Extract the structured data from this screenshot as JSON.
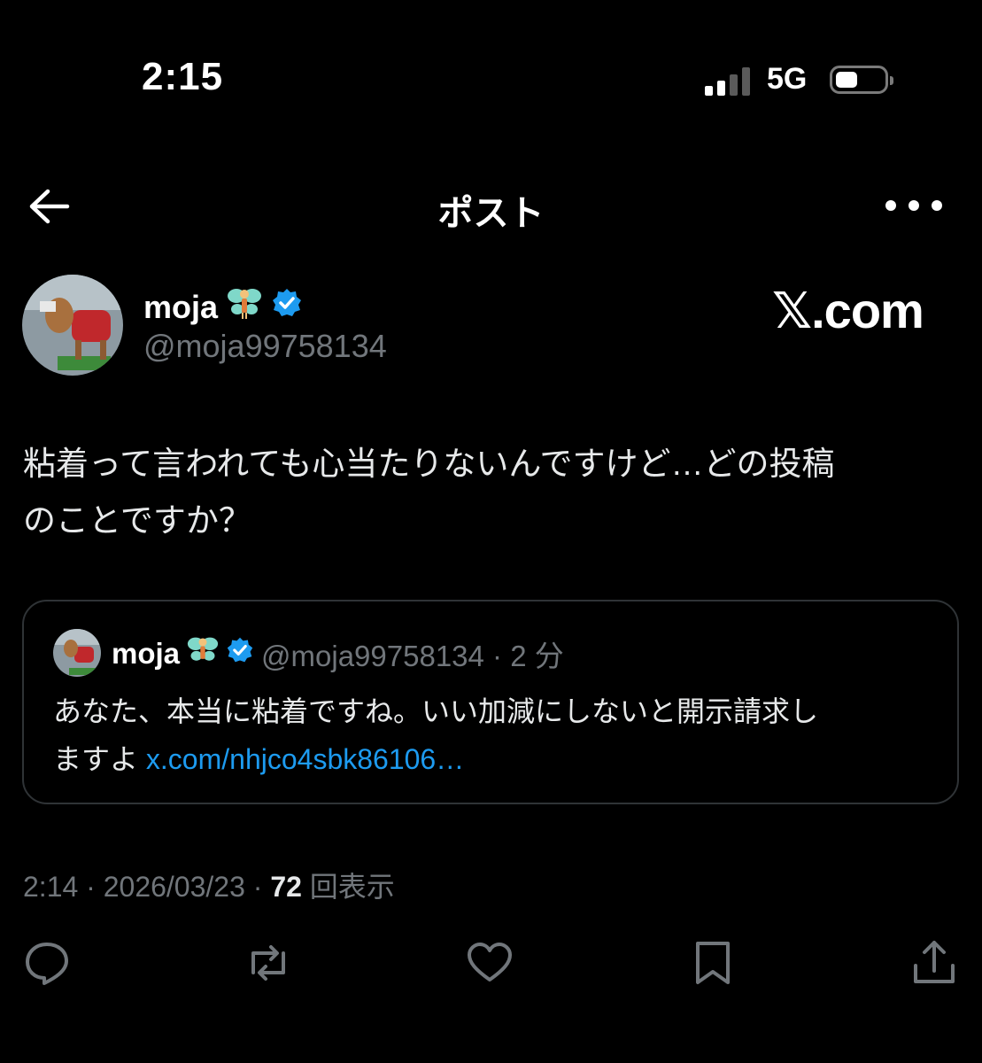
{
  "status_bar": {
    "time": "2:15",
    "network": "5G"
  },
  "nav": {
    "title": "ポスト"
  },
  "author": {
    "display_name": "moja",
    "handle": "@moja99758134"
  },
  "watermark": {
    "x": "𝕏",
    "com": ".com"
  },
  "post": {
    "text_line1": "粘着って言われても心当たりないんですけど…どの投稿",
    "text_line2": "のことですか？"
  },
  "quote": {
    "display_name": "moja",
    "handle_time": "@moja99758134 · 2 分",
    "text_line1": "あなた、本当に粘着ですね。いい加減にしないと開示請求し",
    "text_line2_prefix": "ますよ ",
    "link": "x.com/nhjco4sbk86106…"
  },
  "meta": {
    "time_date": "2:14 · 2026/03/23 · ",
    "views_count": "72",
    "views_label": " 回表示"
  },
  "colors": {
    "link": "#1d9bf0",
    "verified": "#1d9bf0",
    "secondary": "#71767b",
    "border": "#2f3336"
  }
}
